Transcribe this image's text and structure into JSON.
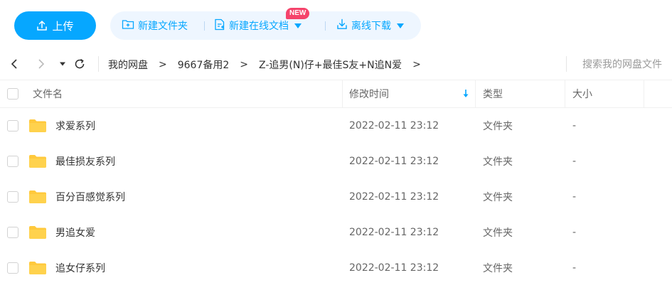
{
  "toolbar": {
    "upload_label": "上传",
    "new_folder_label": "新建文件夹",
    "new_online_doc_label": "新建在线文档",
    "new_badge": "NEW",
    "offline_download_label": "离线下载"
  },
  "navbar": {
    "breadcrumbs": [
      "我的网盘",
      "9667备用2",
      "Z-追男(N)仔+最佳S友+N追N爱"
    ],
    "search_placeholder": "搜索我的网盘文件"
  },
  "table": {
    "headers": {
      "name": "文件名",
      "modified": "修改时间",
      "type": "类型",
      "size": "大小"
    },
    "rows": [
      {
        "name": "求爱系列",
        "modified": "2022-02-11 23:12",
        "type": "文件夹",
        "size": "-"
      },
      {
        "name": "最佳损友系列",
        "modified": "2022-02-11 23:12",
        "type": "文件夹",
        "size": "-"
      },
      {
        "name": "百分百感觉系列",
        "modified": "2022-02-11 23:12",
        "type": "文件夹",
        "size": "-"
      },
      {
        "name": "男追女爱",
        "modified": "2022-02-11 23:12",
        "type": "文件夹",
        "size": "-"
      },
      {
        "name": "追女仔系列",
        "modified": "2022-02-11 23:12",
        "type": "文件夹",
        "size": "-"
      }
    ]
  },
  "colors": {
    "accent": "#06a7ff",
    "badge": "#f5436b",
    "folder": "#ffc93c"
  }
}
